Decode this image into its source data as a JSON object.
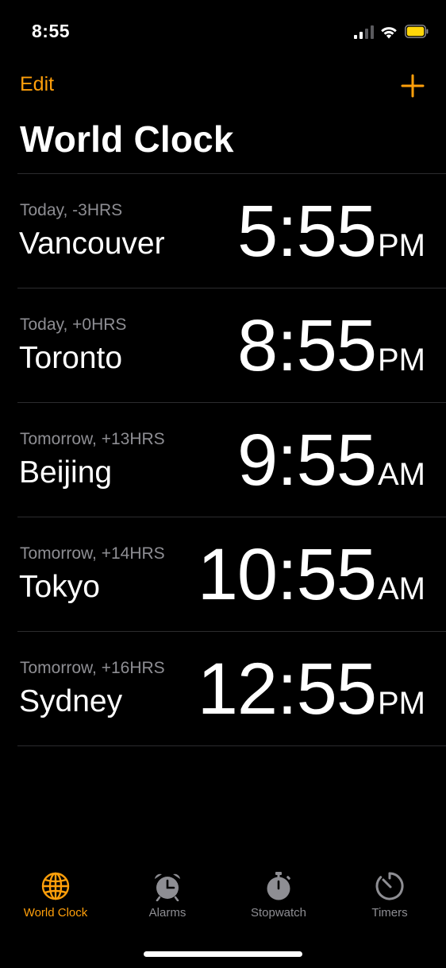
{
  "status_bar": {
    "time": "8:55"
  },
  "nav": {
    "edit_label": "Edit",
    "add_icon": "plus-icon"
  },
  "title": "World Clock",
  "clocks": [
    {
      "offset": "Today, -3HRS",
      "city": "Vancouver",
      "time": "5:55",
      "ampm": "PM"
    },
    {
      "offset": "Today, +0HRS",
      "city": "Toronto",
      "time": "8:55",
      "ampm": "PM"
    },
    {
      "offset": "Tomorrow, +13HRS",
      "city": "Beijing",
      "time": "9:55",
      "ampm": "AM"
    },
    {
      "offset": "Tomorrow, +14HRS",
      "city": "Tokyo",
      "time": "10:55",
      "ampm": "AM"
    },
    {
      "offset": "Tomorrow, +16HRS",
      "city": "Sydney",
      "time": "12:55",
      "ampm": "PM"
    }
  ],
  "tabs": [
    {
      "label": "World Clock",
      "icon": "globe-icon",
      "active": true
    },
    {
      "label": "Alarms",
      "icon": "alarm-clock-icon",
      "active": false
    },
    {
      "label": "Stopwatch",
      "icon": "stopwatch-icon",
      "active": false
    },
    {
      "label": "Timers",
      "icon": "timer-icon",
      "active": false
    }
  ],
  "colors": {
    "accent": "#ff9f0a",
    "inactive": "#8e8e93",
    "battery": "#ffd60a",
    "background": "#000000"
  }
}
